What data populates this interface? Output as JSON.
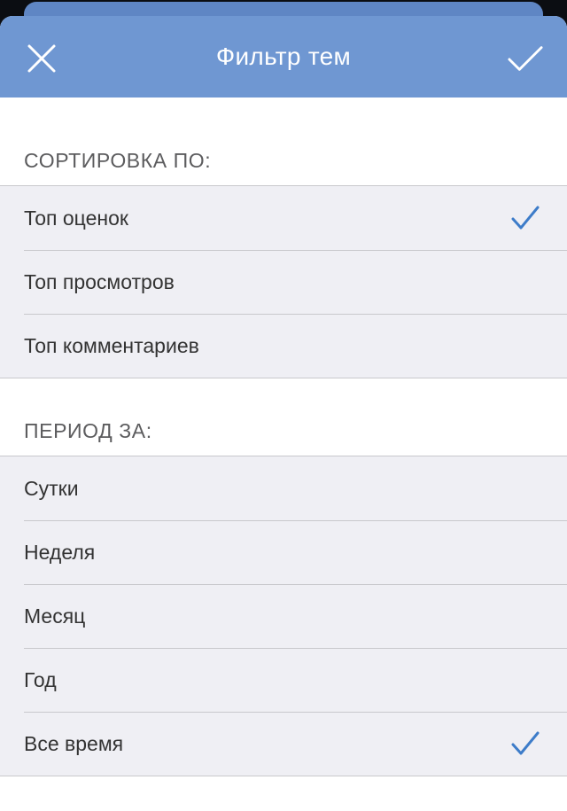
{
  "header": {
    "title": "Фильтр тем",
    "close_icon": "close-icon",
    "confirm_icon": "checkmark-icon",
    "color": "#6f97d2"
  },
  "sort_section": {
    "title": "СОРТИРОВКА ПО:",
    "selected_index": 0,
    "items": [
      {
        "label": "Топ оценок",
        "selected": true
      },
      {
        "label": "Топ просмотров",
        "selected": false
      },
      {
        "label": "Топ комментариев",
        "selected": false
      }
    ]
  },
  "period_section": {
    "title": "ПЕРИОД ЗА:",
    "selected_index": 4,
    "items": [
      {
        "label": "Сутки",
        "selected": false
      },
      {
        "label": "Неделя",
        "selected": false
      },
      {
        "label": "Месяц",
        "selected": false
      },
      {
        "label": "Год",
        "selected": false
      },
      {
        "label": "Все время",
        "selected": true
      }
    ]
  },
  "colors": {
    "accent": "#3d7cc9",
    "list_background": "#efeff4",
    "separator": "#c8c8cc"
  }
}
